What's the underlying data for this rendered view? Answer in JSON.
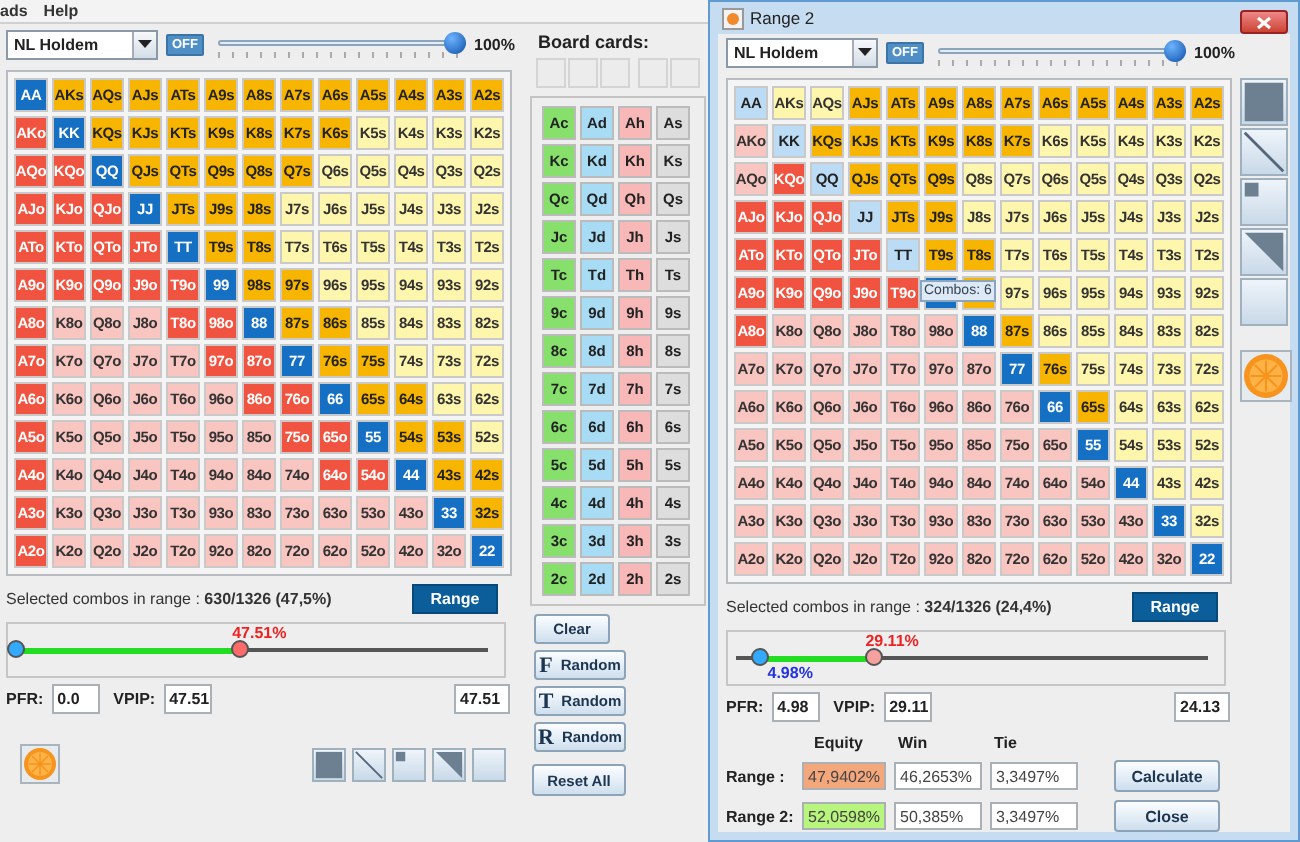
{
  "menu": [
    {
      "label": "ads"
    },
    {
      "label": "Help"
    }
  ],
  "left": {
    "game": "NL Holdem",
    "toggle": "OFF",
    "strength": {
      "level": 1
    },
    "strength_label": "100%",
    "grid": [
      {
        "cells": [
          {
            "label": "AA",
            "selected": true
          },
          {
            "label": "AKs",
            "selected": true
          },
          {
            "label": "AQs",
            "selected": true
          },
          {
            "label": "AJs",
            "selected": true
          },
          {
            "label": "ATs",
            "selected": true
          },
          {
            "label": "A9s",
            "selected": true
          },
          {
            "label": "A8s",
            "selected": true
          },
          {
            "label": "A7s",
            "selected": true
          },
          {
            "label": "A6s",
            "selected": true
          },
          {
            "label": "A5s",
            "selected": true
          },
          {
            "label": "A4s",
            "selected": true
          },
          {
            "label": "A3s",
            "selected": true
          },
          {
            "label": "A2s",
            "selected": true
          }
        ]
      },
      {
        "cells": [
          {
            "label": "AKo",
            "selected": true
          },
          {
            "label": "KK",
            "selected": true
          },
          {
            "label": "KQs",
            "selected": true
          },
          {
            "label": "KJs",
            "selected": true
          },
          {
            "label": "KTs",
            "selected": true
          },
          {
            "label": "K9s",
            "selected": true
          },
          {
            "label": "K8s",
            "selected": true
          },
          {
            "label": "K7s",
            "selected": true
          },
          {
            "label": "K6s",
            "selected": true
          },
          {
            "label": "K5s",
            "selected": false
          },
          {
            "label": "K4s",
            "selected": false
          },
          {
            "label": "K3s",
            "selected": false
          },
          {
            "label": "K2s",
            "selected": false
          }
        ]
      },
      {
        "cells": [
          {
            "label": "AQo",
            "selected": true
          },
          {
            "label": "KQo",
            "selected": true
          },
          {
            "label": "QQ",
            "selected": true
          },
          {
            "label": "QJs",
            "selected": true
          },
          {
            "label": "QTs",
            "selected": true
          },
          {
            "label": "Q9s",
            "selected": true
          },
          {
            "label": "Q8s",
            "selected": true
          },
          {
            "label": "Q7s",
            "selected": true
          },
          {
            "label": "Q6s",
            "selected": false
          },
          {
            "label": "Q5s",
            "selected": false
          },
          {
            "label": "Q4s",
            "selected": false
          },
          {
            "label": "Q3s",
            "selected": false
          },
          {
            "label": "Q2s",
            "selected": false
          }
        ]
      },
      {
        "cells": [
          {
            "label": "AJo",
            "selected": true
          },
          {
            "label": "KJo",
            "selected": true
          },
          {
            "label": "QJo",
            "selected": true
          },
          {
            "label": "JJ",
            "selected": true
          },
          {
            "label": "JTs",
            "selected": true
          },
          {
            "label": "J9s",
            "selected": true
          },
          {
            "label": "J8s",
            "selected": true
          },
          {
            "label": "J7s",
            "selected": false
          },
          {
            "label": "J6s",
            "selected": false
          },
          {
            "label": "J5s",
            "selected": false
          },
          {
            "label": "J4s",
            "selected": false
          },
          {
            "label": "J3s",
            "selected": false
          },
          {
            "label": "J2s",
            "selected": false
          }
        ]
      },
      {
        "cells": [
          {
            "label": "ATo",
            "selected": true
          },
          {
            "label": "KTo",
            "selected": true
          },
          {
            "label": "QTo",
            "selected": true
          },
          {
            "label": "JTo",
            "selected": true
          },
          {
            "label": "TT",
            "selected": true
          },
          {
            "label": "T9s",
            "selected": true
          },
          {
            "label": "T8s",
            "selected": true
          },
          {
            "label": "T7s",
            "selected": false
          },
          {
            "label": "T6s",
            "selected": false
          },
          {
            "label": "T5s",
            "selected": false
          },
          {
            "label": "T4s",
            "selected": false
          },
          {
            "label": "T3s",
            "selected": false
          },
          {
            "label": "T2s",
            "selected": false
          }
        ]
      },
      {
        "cells": [
          {
            "label": "A9o",
            "selected": true
          },
          {
            "label": "K9o",
            "selected": true
          },
          {
            "label": "Q9o",
            "selected": true
          },
          {
            "label": "J9o",
            "selected": true
          },
          {
            "label": "T9o",
            "selected": true
          },
          {
            "label": "99",
            "selected": true
          },
          {
            "label": "98s",
            "selected": true
          },
          {
            "label": "97s",
            "selected": true
          },
          {
            "label": "96s",
            "selected": false
          },
          {
            "label": "95s",
            "selected": false
          },
          {
            "label": "94s",
            "selected": false
          },
          {
            "label": "93s",
            "selected": false
          },
          {
            "label": "92s",
            "selected": false
          }
        ]
      },
      {
        "cells": [
          {
            "label": "A8o",
            "selected": true
          },
          {
            "label": "K8o",
            "selected": false
          },
          {
            "label": "Q8o",
            "selected": false
          },
          {
            "label": "J8o",
            "selected": false
          },
          {
            "label": "T8o",
            "selected": true
          },
          {
            "label": "98o",
            "selected": true
          },
          {
            "label": "88",
            "selected": true
          },
          {
            "label": "87s",
            "selected": true
          },
          {
            "label": "86s",
            "selected": true
          },
          {
            "label": "85s",
            "selected": false
          },
          {
            "label": "84s",
            "selected": false
          },
          {
            "label": "83s",
            "selected": false
          },
          {
            "label": "82s",
            "selected": false
          }
        ]
      },
      {
        "cells": [
          {
            "label": "A7o",
            "selected": true
          },
          {
            "label": "K7o",
            "selected": false
          },
          {
            "label": "Q7o",
            "selected": false
          },
          {
            "label": "J7o",
            "selected": false
          },
          {
            "label": "T7o",
            "selected": false
          },
          {
            "label": "97o",
            "selected": true
          },
          {
            "label": "87o",
            "selected": true
          },
          {
            "label": "77",
            "selected": true
          },
          {
            "label": "76s",
            "selected": true
          },
          {
            "label": "75s",
            "selected": true
          },
          {
            "label": "74s",
            "selected": false
          },
          {
            "label": "73s",
            "selected": false
          },
          {
            "label": "72s",
            "selected": false
          }
        ]
      },
      {
        "cells": [
          {
            "label": "A6o",
            "selected": true
          },
          {
            "label": "K6o",
            "selected": false
          },
          {
            "label": "Q6o",
            "selected": false
          },
          {
            "label": "J6o",
            "selected": false
          },
          {
            "label": "T6o",
            "selected": false
          },
          {
            "label": "96o",
            "selected": false
          },
          {
            "label": "86o",
            "selected": true
          },
          {
            "label": "76o",
            "selected": true
          },
          {
            "label": "66",
            "selected": true
          },
          {
            "label": "65s",
            "selected": true
          },
          {
            "label": "64s",
            "selected": true
          },
          {
            "label": "63s",
            "selected": false
          },
          {
            "label": "62s",
            "selected": false
          }
        ]
      },
      {
        "cells": [
          {
            "label": "A5o",
            "selected": true
          },
          {
            "label": "K5o",
            "selected": false
          },
          {
            "label": "Q5o",
            "selected": false
          },
          {
            "label": "J5o",
            "selected": false
          },
          {
            "label": "T5o",
            "selected": false
          },
          {
            "label": "95o",
            "selected": false
          },
          {
            "label": "85o",
            "selected": false
          },
          {
            "label": "75o",
            "selected": true
          },
          {
            "label": "65o",
            "selected": true
          },
          {
            "label": "55",
            "selected": true
          },
          {
            "label": "54s",
            "selected": true
          },
          {
            "label": "53s",
            "selected": true
          },
          {
            "label": "52s",
            "selected": false
          }
        ]
      },
      {
        "cells": [
          {
            "label": "A4o",
            "selected": true
          },
          {
            "label": "K4o",
            "selected": false
          },
          {
            "label": "Q4o",
            "selected": false
          },
          {
            "label": "J4o",
            "selected": false
          },
          {
            "label": "T4o",
            "selected": false
          },
          {
            "label": "94o",
            "selected": false
          },
          {
            "label": "84o",
            "selected": false
          },
          {
            "label": "74o",
            "selected": false
          },
          {
            "label": "64o",
            "selected": true
          },
          {
            "label": "54o",
            "selected": true
          },
          {
            "label": "44",
            "selected": true
          },
          {
            "label": "43s",
            "selected": true
          },
          {
            "label": "42s",
            "selected": true
          }
        ]
      },
      {
        "cells": [
          {
            "label": "A3o",
            "selected": true
          },
          {
            "label": "K3o",
            "selected": false
          },
          {
            "label": "Q3o",
            "selected": false
          },
          {
            "label": "J3o",
            "selected": false
          },
          {
            "label": "T3o",
            "selected": false
          },
          {
            "label": "93o",
            "selected": false
          },
          {
            "label": "83o",
            "selected": false
          },
          {
            "label": "73o",
            "selected": false
          },
          {
            "label": "63o",
            "selected": false
          },
          {
            "label": "53o",
            "selected": false
          },
          {
            "label": "43o",
            "selected": false
          },
          {
            "label": "33",
            "selected": true
          },
          {
            "label": "32s",
            "selected": true
          }
        ]
      },
      {
        "cells": [
          {
            "label": "A2o",
            "selected": true
          },
          {
            "label": "K2o",
            "selected": false
          },
          {
            "label": "Q2o",
            "selected": false
          },
          {
            "label": "J2o",
            "selected": false
          },
          {
            "label": "T2o",
            "selected": false
          },
          {
            "label": "92o",
            "selected": false
          },
          {
            "label": "82o",
            "selected": false
          },
          {
            "label": "72o",
            "selected": false
          },
          {
            "label": "62o",
            "selected": false
          },
          {
            "label": "52o",
            "selected": false
          },
          {
            "label": "42o",
            "selected": false
          },
          {
            "label": "32o",
            "selected": false
          },
          {
            "label": "22",
            "selected": true
          }
        ]
      }
    ],
    "summary": "Selected combos in range : **630/1326 (47,5%)**",
    "range_button": "Range",
    "slider": {
      "thumbs": [
        {
          "level": 0,
          "color": "#33aaff"
        },
        {
          "level": 0.4751,
          "color": "#ff6b6b",
          "label": "47.51%"
        }
      ]
    },
    "pfr_label": "PFR:",
    "pfr": "0.0",
    "vpip_label": "VPIP:",
    "vpip": "47.51",
    "extra": "47.51"
  },
  "board": {
    "title": "Board cards:",
    "suits": [
      {
        "color": "#86e06b",
        "cards": [
          "Ac",
          "Kc",
          "Qc",
          "Jc",
          "Tc",
          "9c",
          "8c",
          "7c",
          "6c",
          "5c",
          "4c",
          "3c",
          "2c"
        ]
      },
      {
        "color": "#a8dcf5",
        "cards": [
          "Ad",
          "Kd",
          "Qd",
          "Jd",
          "Td",
          "9d",
          "8d",
          "7d",
          "6d",
          "5d",
          "4d",
          "3d",
          "2d"
        ]
      },
      {
        "color": "#f8b8b8",
        "cards": [
          "Ah",
          "Kh",
          "Qh",
          "Jh",
          "Th",
          "9h",
          "8h",
          "7h",
          "6h",
          "5h",
          "4h",
          "3h",
          "2h"
        ]
      },
      {
        "color": "#dddddd",
        "cards": [
          "As",
          "Ks",
          "Qs",
          "Js",
          "Ts",
          "9s",
          "8s",
          "7s",
          "6s",
          "5s",
          "4s",
          "3s",
          "2s"
        ]
      }
    ],
    "buttons": [
      {
        "kind": "clear",
        "label": "Clear"
      },
      {
        "kind": "random",
        "letter": "F",
        "label": "Random"
      },
      {
        "kind": "random",
        "letter": "T",
        "label": "Random"
      },
      {
        "kind": "random",
        "letter": "R",
        "label": "Random"
      },
      {
        "kind": "reset",
        "label": "Reset All"
      }
    ]
  },
  "window2": {
    "title": "Range 2",
    "range": {
      "game": "NL Holdem",
      "toggle": "OFF",
      "strength": {
        "level": 1
      },
      "strength_label": "100%",
      "grid": [
        {
          "cells": [
            {
              "label": "AA",
              "selected": false
            },
            {
              "label": "AKs",
              "selected": false
            },
            {
              "label": "AQs",
              "selected": false
            },
            {
              "label": "AJs",
              "selected": true
            },
            {
              "label": "ATs",
              "selected": true
            },
            {
              "label": "A9s",
              "selected": true
            },
            {
              "label": "A8s",
              "selected": true
            },
            {
              "label": "A7s",
              "selected": true
            },
            {
              "label": "A6s",
              "selected": true
            },
            {
              "label": "A5s",
              "selected": true
            },
            {
              "label": "A4s",
              "selected": true
            },
            {
              "label": "A3s",
              "selected": true
            },
            {
              "label": "A2s",
              "selected": true
            }
          ]
        },
        {
          "cells": [
            {
              "label": "AKo",
              "selected": false
            },
            {
              "label": "KK",
              "selected": false
            },
            {
              "label": "KQs",
              "selected": true
            },
            {
              "label": "KJs",
              "selected": true
            },
            {
              "label": "KTs",
              "selected": true
            },
            {
              "label": "K9s",
              "selected": true
            },
            {
              "label": "K8s",
              "selected": true
            },
            {
              "label": "K7s",
              "selected": true
            },
            {
              "label": "K6s",
              "selected": false
            },
            {
              "label": "K5s",
              "selected": false
            },
            {
              "label": "K4s",
              "selected": false
            },
            {
              "label": "K3s",
              "selected": false
            },
            {
              "label": "K2s",
              "selected": false
            }
          ]
        },
        {
          "cells": [
            {
              "label": "AQo",
              "selected": false
            },
            {
              "label": "KQo",
              "selected": true
            },
            {
              "label": "QQ",
              "selected": false
            },
            {
              "label": "QJs",
              "selected": true
            },
            {
              "label": "QTs",
              "selected": true
            },
            {
              "label": "Q9s",
              "selected": true
            },
            {
              "label": "Q8s",
              "selected": false
            },
            {
              "label": "Q7s",
              "selected": false
            },
            {
              "label": "Q6s",
              "selected": false
            },
            {
              "label": "Q5s",
              "selected": false
            },
            {
              "label": "Q4s",
              "selected": false
            },
            {
              "label": "Q3s",
              "selected": false
            },
            {
              "label": "Q2s",
              "selected": false
            }
          ]
        },
        {
          "cells": [
            {
              "label": "AJo",
              "selected": true
            },
            {
              "label": "KJo",
              "selected": true
            },
            {
              "label": "QJo",
              "selected": true
            },
            {
              "label": "JJ",
              "selected": false
            },
            {
              "label": "JTs",
              "selected": true
            },
            {
              "label": "J9s",
              "selected": true
            },
            {
              "label": "J8s",
              "selected": false
            },
            {
              "label": "J7s",
              "selected": false
            },
            {
              "label": "J6s",
              "selected": false
            },
            {
              "label": "J5s",
              "selected": false
            },
            {
              "label": "J4s",
              "selected": false
            },
            {
              "label": "J3s",
              "selected": false
            },
            {
              "label": "J2s",
              "selected": false
            }
          ]
        },
        {
          "cells": [
            {
              "label": "ATo",
              "selected": true
            },
            {
              "label": "KTo",
              "selected": true
            },
            {
              "label": "QTo",
              "selected": true
            },
            {
              "label": "JTo",
              "selected": true
            },
            {
              "label": "TT",
              "selected": false
            },
            {
              "label": "T9s",
              "selected": true
            },
            {
              "label": "T8s",
              "selected": true
            },
            {
              "label": "T7s",
              "selected": false
            },
            {
              "label": "T6s",
              "selected": false
            },
            {
              "label": "T5s",
              "selected": false
            },
            {
              "label": "T4s",
              "selected": false
            },
            {
              "label": "T3s",
              "selected": false
            },
            {
              "label": "T2s",
              "selected": false
            }
          ]
        },
        {
          "cells": [
            {
              "label": "A9o",
              "selected": true
            },
            {
              "label": "K9o",
              "selected": true
            },
            {
              "label": "Q9o",
              "selected": true
            },
            {
              "label": "J9o",
              "selected": true
            },
            {
              "label": "T9o",
              "selected": true
            },
            {
              "selected": true
            },
            {
              "selected": true
            },
            {
              "label": "97s",
              "selected": false
            },
            {
              "label": "96s",
              "selected": false
            },
            {
              "label": "95s",
              "selected": false
            },
            {
              "label": "94s",
              "selected": false
            },
            {
              "label": "93s",
              "selected": false
            },
            {
              "label": "92s",
              "selected": false
            }
          ]
        },
        {
          "cells": [
            {
              "label": "A8o",
              "selected": true
            },
            {
              "label": "K8o",
              "selected": false
            },
            {
              "label": "Q8o",
              "selected": false
            },
            {
              "label": "J8o",
              "selected": false
            },
            {
              "label": "T8o",
              "selected": false
            },
            {
              "label": "98o",
              "selected": false
            },
            {
              "label": "88",
              "selected": true
            },
            {
              "label": "87s",
              "selected": true
            },
            {
              "label": "86s",
              "selected": false
            },
            {
              "label": "85s",
              "selected": false
            },
            {
              "label": "84s",
              "selected": false
            },
            {
              "label": "83s",
              "selected": false
            },
            {
              "label": "82s",
              "selected": false
            }
          ]
        },
        {
          "cells": [
            {
              "label": "A7o",
              "selected": false
            },
            {
              "label": "K7o",
              "selected": false
            },
            {
              "label": "Q7o",
              "selected": false
            },
            {
              "label": "J7o",
              "selected": false
            },
            {
              "label": "T7o",
              "selected": false
            },
            {
              "label": "97o",
              "selected": false
            },
            {
              "label": "87o",
              "selected": false
            },
            {
              "label": "77",
              "selected": true
            },
            {
              "label": "76s",
              "selected": true
            },
            {
              "label": "75s",
              "selected": false
            },
            {
              "label": "74s",
              "selected": false
            },
            {
              "label": "73s",
              "selected": false
            },
            {
              "label": "72s",
              "selected": false
            }
          ]
        },
        {
          "cells": [
            {
              "label": "A6o",
              "selected": false
            },
            {
              "label": "K6o",
              "selected": false
            },
            {
              "label": "Q6o",
              "selected": false
            },
            {
              "label": "J6o",
              "selected": false
            },
            {
              "label": "T6o",
              "selected": false
            },
            {
              "label": "96o",
              "selected": false
            },
            {
              "label": "86o",
              "selected": false
            },
            {
              "label": "76o",
              "selected": false
            },
            {
              "label": "66",
              "selected": true
            },
            {
              "label": "65s",
              "selected": true
            },
            {
              "label": "64s",
              "selected": false
            },
            {
              "label": "63s",
              "selected": false
            },
            {
              "label": "62s",
              "selected": false
            }
          ]
        },
        {
          "cells": [
            {
              "label": "A5o",
              "selected": false
            },
            {
              "label": "K5o",
              "selected": false
            },
            {
              "label": "Q5o",
              "selected": false
            },
            {
              "label": "J5o",
              "selected": false
            },
            {
              "label": "T5o",
              "selected": false
            },
            {
              "label": "95o",
              "selected": false
            },
            {
              "label": "85o",
              "selected": false
            },
            {
              "label": "75o",
              "selected": false
            },
            {
              "label": "65o",
              "selected": false
            },
            {
              "label": "55",
              "selected": true
            },
            {
              "label": "54s",
              "selected": false
            },
            {
              "label": "53s",
              "selected": false
            },
            {
              "label": "52s",
              "selected": false
            }
          ]
        },
        {
          "cells": [
            {
              "label": "A4o",
              "selected": false
            },
            {
              "label": "K4o",
              "selected": false
            },
            {
              "label": "Q4o",
              "selected": false
            },
            {
              "label": "J4o",
              "selected": false
            },
            {
              "label": "T4o",
              "selected": false
            },
            {
              "label": "94o",
              "selected": false
            },
            {
              "label": "84o",
              "selected": false
            },
            {
              "label": "74o",
              "selected": false
            },
            {
              "label": "64o",
              "selected": false
            },
            {
              "label": "54o",
              "selected": false
            },
            {
              "label": "44",
              "selected": true
            },
            {
              "label": "43s",
              "selected": false
            },
            {
              "label": "42s",
              "selected": false
            }
          ]
        },
        {
          "cells": [
            {
              "label": "A3o",
              "selected": false
            },
            {
              "label": "K3o",
              "selected": false
            },
            {
              "label": "Q3o",
              "selected": false
            },
            {
              "label": "J3o",
              "selected": false
            },
            {
              "label": "T3o",
              "selected": false
            },
            {
              "label": "93o",
              "selected": false
            },
            {
              "label": "83o",
              "selected": false
            },
            {
              "label": "73o",
              "selected": false
            },
            {
              "label": "63o",
              "selected": false
            },
            {
              "label": "53o",
              "selected": false
            },
            {
              "label": "43o",
              "selected": false
            },
            {
              "label": "33",
              "selected": true
            },
            {
              "label": "32s",
              "selected": false
            }
          ]
        },
        {
          "cells": [
            {
              "label": "A2o",
              "selected": false
            },
            {
              "label": "K2o",
              "selected": false
            },
            {
              "label": "Q2o",
              "selected": false
            },
            {
              "label": "J2o",
              "selected": false
            },
            {
              "label": "T2o",
              "selected": false
            },
            {
              "label": "92o",
              "selected": false
            },
            {
              "label": "82o",
              "selected": false
            },
            {
              "label": "72o",
              "selected": false
            },
            {
              "label": "62o",
              "selected": false
            },
            {
              "label": "52o",
              "selected": false
            },
            {
              "label": "42o",
              "selected": false
            },
            {
              "label": "32o",
              "selected": false
            },
            {
              "label": "22",
              "selected": true
            }
          ]
        }
      ],
      "tooltip": "Combos: 6",
      "summary": "Selected combos in range : **324/1326 (24,4%)**",
      "range_button": "Range",
      "slider": {
        "thumbs": [
          {
            "level": 0.0498,
            "color": "#33aaff",
            "label": "4.98%"
          },
          {
            "level": 0.2911,
            "color": "#f7a0a0",
            "label": "29.11%"
          }
        ]
      },
      "pfr_label": "PFR:",
      "pfr": "4.98",
      "vpip_label": "VPIP:",
      "vpip": "29.11",
      "extra": "24.13"
    },
    "equity": {
      "headers": [
        "Equity",
        "Win",
        "Tie"
      ],
      "rows": [
        {
          "label": "Range :",
          "equity": "47,9402%",
          "color": "#f5a77c",
          "win": "46,2653%",
          "tie": "3,3497%"
        },
        {
          "label": "Range 2:",
          "equity": "52,0598%",
          "color": "#b8f57c",
          "win": "50,385%",
          "tie": "3,3497%"
        }
      ]
    },
    "buttons": [
      "Calculate",
      "Close"
    ]
  }
}
